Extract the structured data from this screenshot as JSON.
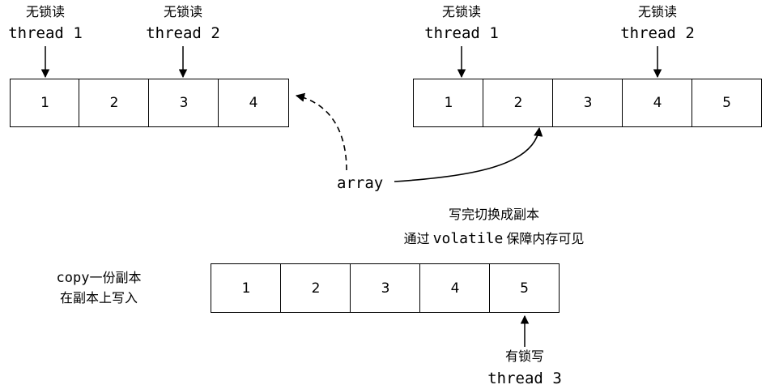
{
  "top_left": {
    "readers": [
      {
        "lock": "无锁读",
        "thread": "thread 1"
      },
      {
        "lock": "无锁读",
        "thread": "thread 2"
      }
    ],
    "cells": [
      "1",
      "2",
      "3",
      "4"
    ]
  },
  "top_right": {
    "readers": [
      {
        "lock": "无锁读",
        "thread": "thread 1"
      },
      {
        "lock": "无锁读",
        "thread": "thread 2"
      }
    ],
    "cells": [
      "1",
      "2",
      "3",
      "4",
      "5"
    ]
  },
  "array_label": "array",
  "switch_note": {
    "line1": "写完切换成副本",
    "line2_prefix": "通过",
    "line2_code": "volatile",
    "line2_suffix": "保障内存可见"
  },
  "copy_note": {
    "line1_code": "copy",
    "line1_text": "一份副本",
    "line2": "在副本上写入"
  },
  "bottom": {
    "cells": [
      "1",
      "2",
      "3",
      "4",
      "5"
    ],
    "writer": {
      "lock": "有锁写",
      "thread": "thread 3"
    }
  }
}
